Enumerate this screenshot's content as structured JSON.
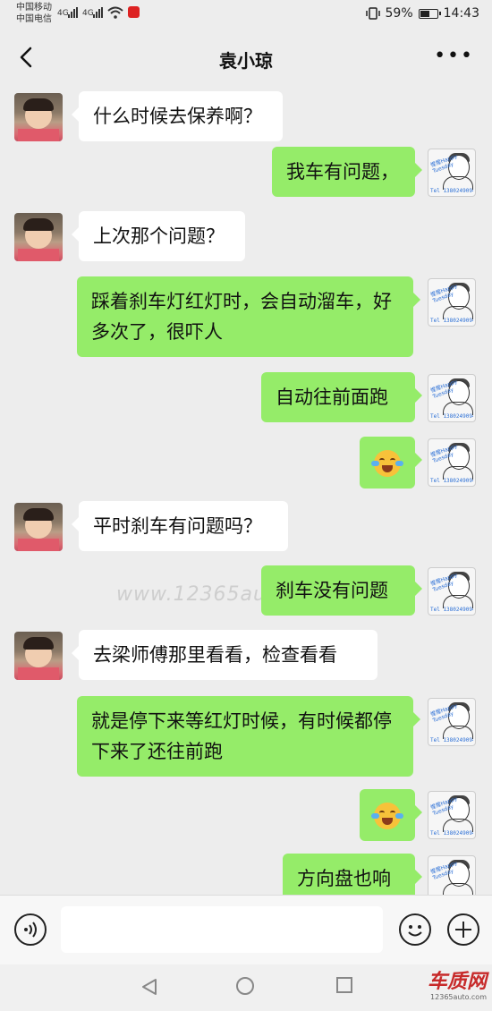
{
  "status_bar": {
    "carrier1": "中国移动",
    "carrier2": "中国电信",
    "net1": "4G",
    "net2": "4G",
    "battery_pct": "59%",
    "battery_level": 0.59,
    "time": "14:43"
  },
  "header": {
    "title": "袁小琼"
  },
  "messages": [
    {
      "side": "left",
      "text": "什么时候去保养啊？"
    },
    {
      "side": "right",
      "text": "我车有问题，"
    },
    {
      "side": "left",
      "text": "上次那个问题？"
    },
    {
      "side": "right",
      "text": "踩着刹车灯红灯时，会自动溜车，好多次了，很吓人"
    },
    {
      "side": "right",
      "text": "自动往前面跑"
    },
    {
      "side": "right",
      "emoji": "laughing-crying-emoji"
    },
    {
      "side": "left",
      "text": "平时刹车有问题吗？"
    },
    {
      "side": "right",
      "text": "刹车没有问题"
    },
    {
      "side": "left",
      "text": "去梁师傅那里看看，检查看看"
    },
    {
      "side": "right",
      "text": "就是停下来等红灯时候，有时候都停下来了还往前跑"
    },
    {
      "side": "right",
      "emoji": "crying-emoji"
    },
    {
      "side": "right",
      "text": "方向盘也响"
    }
  ],
  "my_avatar": {
    "tag": "惺惺Happy Tuesday",
    "tel": "Tel 13802490946"
  },
  "watermark": "www.12365auto.com",
  "brand": {
    "name": "车质网",
    "url": "12365auto.com"
  },
  "colors": {
    "bubble_right": "#95ec69",
    "bubble_left": "#ffffff",
    "background": "#ededed"
  }
}
